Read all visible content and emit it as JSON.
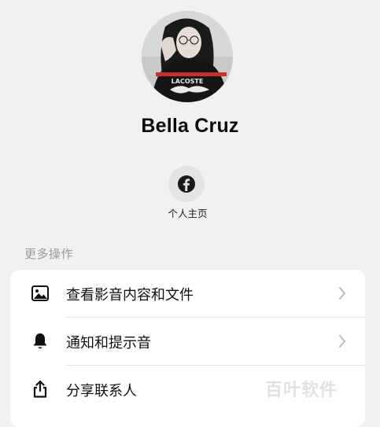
{
  "profile": {
    "name": "Bella Cruz",
    "avatar_icon": "profile-photo",
    "shirt_text": "LACOSTE"
  },
  "facebook": {
    "icon": "facebook-icon",
    "label": "个人主页",
    "accent": "#1a1a1a"
  },
  "more_actions": {
    "title": "更多操作",
    "items": [
      {
        "icon": "image-icon",
        "label": "查看影音内容和文件",
        "has_chevron": true
      },
      {
        "icon": "bell-icon",
        "label": "通知和提示音",
        "has_chevron": true
      },
      {
        "icon": "share-icon",
        "label": "分享联系人",
        "has_chevron": false
      }
    ]
  },
  "watermark": "百叶软件"
}
